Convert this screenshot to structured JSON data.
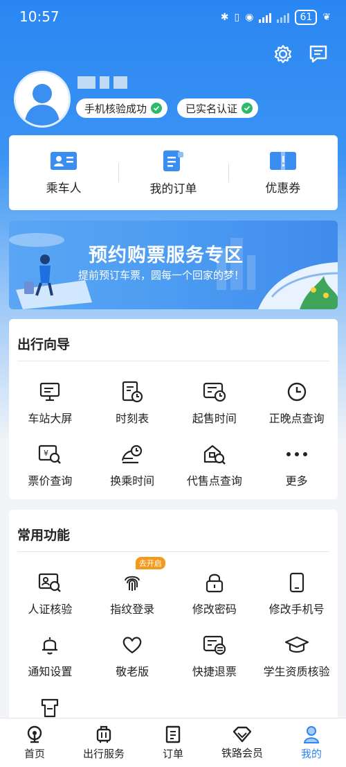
{
  "status_bar": {
    "time": "10:57",
    "battery": "61"
  },
  "header": {
    "badges": [
      "手机核验成功",
      "已实名认证"
    ]
  },
  "quick_links": [
    {
      "label": "乘车人",
      "icon": "passenger-card-icon"
    },
    {
      "label": "我的订单",
      "icon": "order-doc-icon"
    },
    {
      "label": "优惠券",
      "icon": "coupon-icon"
    }
  ],
  "banner": {
    "title": "预约购票服务专区",
    "subtitle": "提前预订车票，圆每一个回家的梦！"
  },
  "travel_guide": {
    "title": "出行向导",
    "items": [
      {
        "label": "车站大屏",
        "icon": "station-screen-icon"
      },
      {
        "label": "时刻表",
        "icon": "timetable-icon"
      },
      {
        "label": "起售时间",
        "icon": "sale-time-icon"
      },
      {
        "label": "正晚点查询",
        "icon": "clock-icon"
      },
      {
        "label": "票价查询",
        "icon": "fare-query-icon"
      },
      {
        "label": "换乘时间",
        "icon": "transfer-time-icon"
      },
      {
        "label": "代售点查询",
        "icon": "agency-search-icon"
      },
      {
        "label": "更多",
        "icon": "more-dots-icon"
      }
    ]
  },
  "common_functions": {
    "title": "常用功能",
    "items": [
      {
        "label": "人证核验",
        "icon": "id-verify-icon"
      },
      {
        "label": "指纹登录",
        "icon": "fingerprint-icon",
        "tag": "去开启"
      },
      {
        "label": "修改密码",
        "icon": "lock-icon"
      },
      {
        "label": "修改手机号",
        "icon": "phone-icon"
      },
      {
        "label": "通知设置",
        "icon": "bell-icon"
      },
      {
        "label": "敬老版",
        "icon": "heart-icon"
      },
      {
        "label": "快捷退票",
        "icon": "refund-ticket-icon"
      },
      {
        "label": "学生资质核验",
        "icon": "graduation-cap-icon"
      }
    ]
  },
  "bottom_nav": [
    {
      "label": "首页",
      "icon": "home-icon"
    },
    {
      "label": "出行服务",
      "icon": "luggage-icon"
    },
    {
      "label": "订单",
      "icon": "order-list-icon"
    },
    {
      "label": "铁路会员",
      "icon": "diamond-icon"
    },
    {
      "label": "我的",
      "icon": "user-icon",
      "active": true
    }
  ],
  "colors": {
    "primary": "#2a86f2",
    "success": "#2cbb68",
    "tag": "#f39a1e"
  }
}
